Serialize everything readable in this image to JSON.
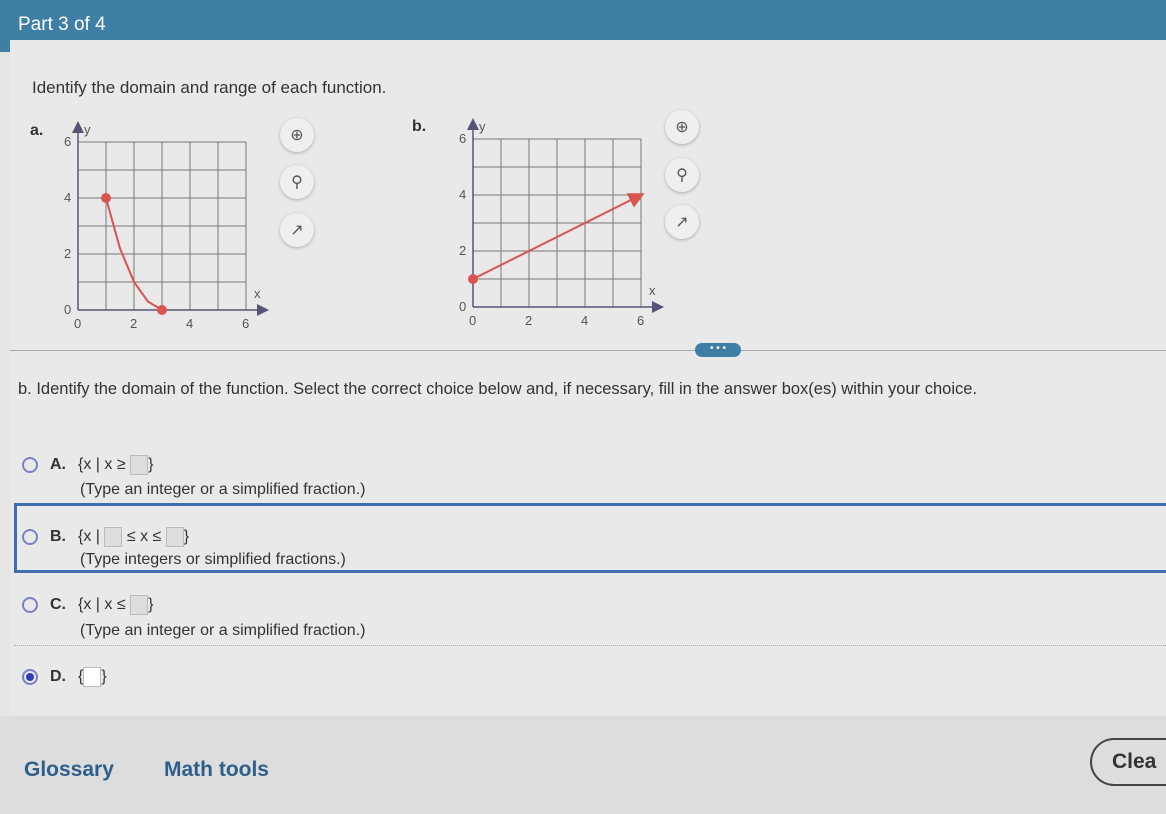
{
  "header": {
    "part": "Part 3 of 4"
  },
  "question": "Identify the domain and range of each function.",
  "graphs": {
    "a_label": "a.",
    "b_label": "b."
  },
  "icons": {
    "zoom_in": "zoom-in-icon",
    "zoom_out": "zoom-out-icon",
    "popout": "popout-icon"
  },
  "more_label": "• • •",
  "instruction": "b. Identify the domain of the function. Select the correct choice below and, if necessary, fill in the answer box(es) within your choice.",
  "choices": [
    {
      "letter": "A.",
      "pre": "{x | x ≥",
      "post": "}",
      "hint": "(Type an integer or a simplified fraction.)"
    },
    {
      "letter": "B.",
      "pre": "{x |",
      "mid": "≤ x ≤",
      "post": "}",
      "hint": "(Type integers or simplified fractions.)"
    },
    {
      "letter": "C.",
      "pre": "{x | x ≤",
      "post": "}",
      "hint": "(Type an integer or a simplified fraction.)"
    },
    {
      "letter": "D.",
      "pre": "{",
      "post": "}",
      "selected": true
    }
  ],
  "footer": {
    "glossary": "Glossary",
    "math_tools": "Math tools",
    "clear": "Clea"
  },
  "chart_data": [
    {
      "type": "line",
      "xlabel": "x",
      "ylabel": "y",
      "xlim": [
        0,
        6
      ],
      "ylim": [
        0,
        6
      ],
      "xticks": [
        0,
        2,
        4,
        6
      ],
      "yticks": [
        0,
        2,
        4,
        6
      ],
      "grid": true,
      "color": "#d9534f",
      "points": [
        [
          1,
          4
        ],
        [
          1.5,
          2.2
        ],
        [
          2,
          1
        ],
        [
          2.5,
          0.3
        ],
        [
          3,
          0
        ]
      ],
      "endpoints": [
        [
          1,
          4
        ],
        [
          3,
          0
        ]
      ],
      "arrow": false
    },
    {
      "type": "line",
      "xlabel": "x",
      "ylabel": "y",
      "xlim": [
        0,
        6
      ],
      "ylim": [
        0,
        6
      ],
      "xticks": [
        0,
        2,
        4,
        6
      ],
      "yticks": [
        0,
        2,
        4,
        6
      ],
      "grid": true,
      "color": "#d9534f",
      "points": [
        [
          0,
          1
        ],
        [
          6,
          4
        ]
      ],
      "endpoints": [
        [
          0,
          1
        ]
      ],
      "arrow": true
    }
  ]
}
